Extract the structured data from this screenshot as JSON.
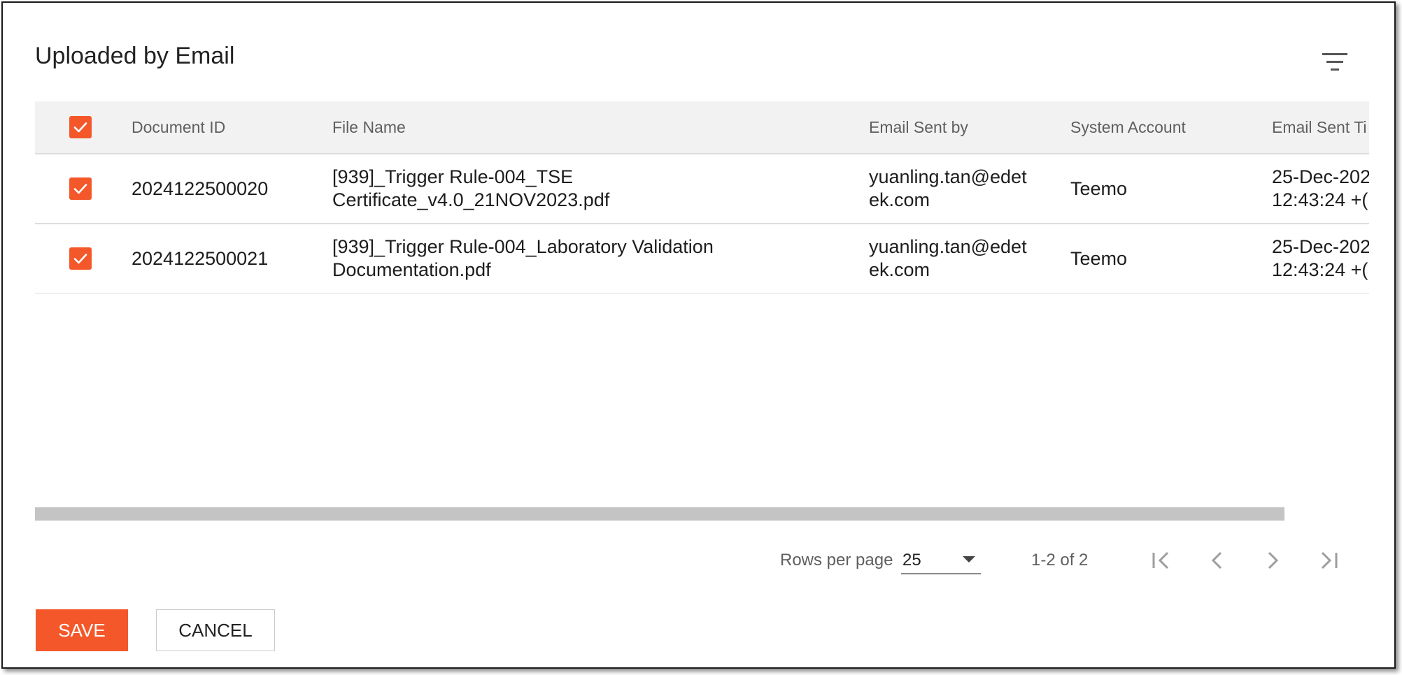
{
  "dialog": {
    "title": "Uploaded by Email"
  },
  "table": {
    "columns": [
      "Document ID",
      "File Name",
      "Email Sent by",
      "System Account",
      "Email Sent Ti"
    ],
    "rows": [
      {
        "checked": true,
        "document_id": "2024122500020",
        "file_name": "[939]_Trigger Rule-004_TSE Certificate_v4.0_21NOV2023.pdf",
        "email_sent_by": "yuanling.tan@edetek.com",
        "system_account": "Teemo",
        "email_sent_time": "25-Dec-202 12:43:24 +("
      },
      {
        "checked": true,
        "document_id": "2024122500021",
        "file_name": "[939]_Trigger Rule-004_Laboratory Validation Documentation.pdf",
        "email_sent_by": "yuanling.tan@edetek.com",
        "system_account": "Teemo",
        "email_sent_time": "25-Dec-202 12:43:24 +("
      }
    ]
  },
  "pagination": {
    "rows_per_page_label": "Rows per page",
    "rows_per_page_value": "25",
    "range_text": "1-2 of 2"
  },
  "actions": {
    "save_label": "SAVE",
    "cancel_label": "CANCEL"
  },
  "colors": {
    "accent": "#f4582a",
    "header_bg": "#f2f2f2",
    "scrollbar": "#c4c4c4"
  },
  "icons": {
    "filter": "filter-icon",
    "checkbox": "check-icon",
    "first": "first-page-icon",
    "prev": "chevron-left-icon",
    "next": "chevron-right-icon",
    "last": "last-page-icon"
  }
}
